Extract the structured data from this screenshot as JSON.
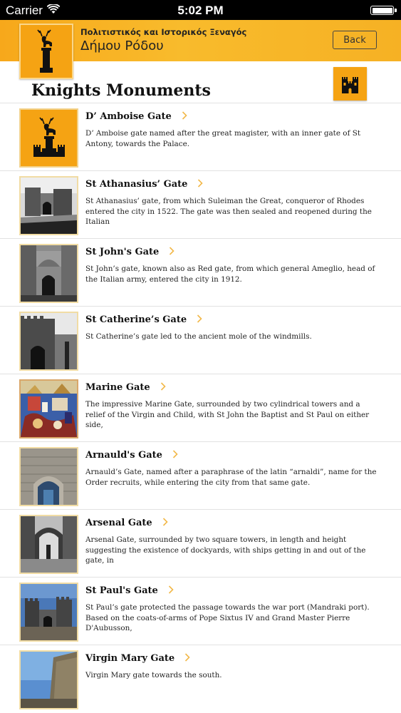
{
  "status_bar": {
    "carrier": "Carrier",
    "time": "5:02 PM",
    "battery_level": 1.0
  },
  "header": {
    "subtitle": "Πολιτιστικός και Ιστορικός Ξεναγός",
    "title": "Δήμου Ρόδου",
    "back_label": "Back",
    "logo_icon": "deer-statue-icon",
    "accent_color": "#f7a81b"
  },
  "page": {
    "title": "Knights Monuments",
    "castle_icon": "castle-icon"
  },
  "monuments": [
    {
      "title": "D’ Amboise Gate",
      "description": "D’ Amboise gate named after the great magister, with an inner gate of St Antony, towards the Palace.",
      "thumbnail": "deer-statue-logo"
    },
    {
      "title": "St Athanasius’ Gate",
      "description": "St Athanasius’ gate, from which Suleiman the Great, conqueror of Rhodes entered the city in 1522. The gate was then sealed and reopened during the Italian",
      "thumbnail": "black-and-white-gate-photo"
    },
    {
      "title": "St John's Gate",
      "description": "St John’s gate, known also as Red gate, from which general Ameglio, head of the Italian army, entered the city in 1912.",
      "thumbnail": "black-and-white-gate-photo"
    },
    {
      "title": "St Catherine’s Gate",
      "description": "St Catherine’s gate led to the ancient mole of the windmills.",
      "thumbnail": "black-and-white-wall-photo"
    },
    {
      "title": "Marine Gate",
      "description": "The impressive Marine Gate, surrounded by two cylindrical towers and a relief of the Virgin and  Child, with St John the Baptist and St Paul on either side,",
      "thumbnail": "painted-illustration"
    },
    {
      "title": "Arnauld's Gate",
      "description": "Arnauld’s Gate, named after a paraphrase of the latin “arnaldi”, name for the Order recruits, while entering the city from that same gate.",
      "thumbnail": "stone-gate-photo"
    },
    {
      "title": "Arsenal Gate",
      "description": "Arsenal Gate, surrounded by two square towers, in length and height suggesting the existence of dockyards, with ships getting in and out of the gate, in",
      "thumbnail": "black-and-white-arch-photo"
    },
    {
      "title": "St Paul's Gate",
      "description": "St Paul’s gate protected the passage towards the war port (Mandraki port). Based on the coats-of-arms of Pope Sixtus IV and Grand Master Pierre D'Aubusson,",
      "thumbnail": "fortress-sky-photo"
    },
    {
      "title": "Virgin Mary Gate",
      "description": "Virgin Mary gate towards the south.",
      "thumbnail": "wall-sky-photo"
    }
  ]
}
